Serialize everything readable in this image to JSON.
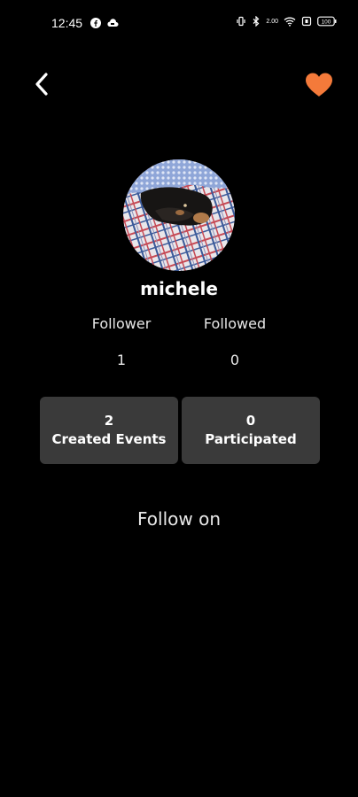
{
  "status_bar": {
    "time": "12:45",
    "left_icons": [
      "facebook-icon",
      "cloud-icon"
    ],
    "right_icons": [
      "vibrate-icon",
      "bluetooth-icon",
      "data-speed-icon",
      "wifi-icon",
      "sim-icon",
      "battery-icon"
    ],
    "data_speed": "2.00",
    "battery": "100"
  },
  "header": {
    "back_icon": "chevron-left-icon",
    "favorite_icon": "heart-icon",
    "favorite_color": "#F47A3A"
  },
  "profile": {
    "username": "michele",
    "avatar": "dog-on-plaid-blanket-photo"
  },
  "stats": {
    "follower_label": "Follower",
    "follower_count": "1",
    "followed_label": "Followed",
    "followed_count": "0"
  },
  "cards": {
    "created": {
      "count": "2",
      "label": "Created Events"
    },
    "participated": {
      "count": "0",
      "label": "Participated"
    }
  },
  "follow_on": {
    "label": "Follow on"
  },
  "colors": {
    "background": "#000000",
    "card": "#3A3A3A",
    "accent": "#F47A3A",
    "text": "#FFFFFF"
  }
}
